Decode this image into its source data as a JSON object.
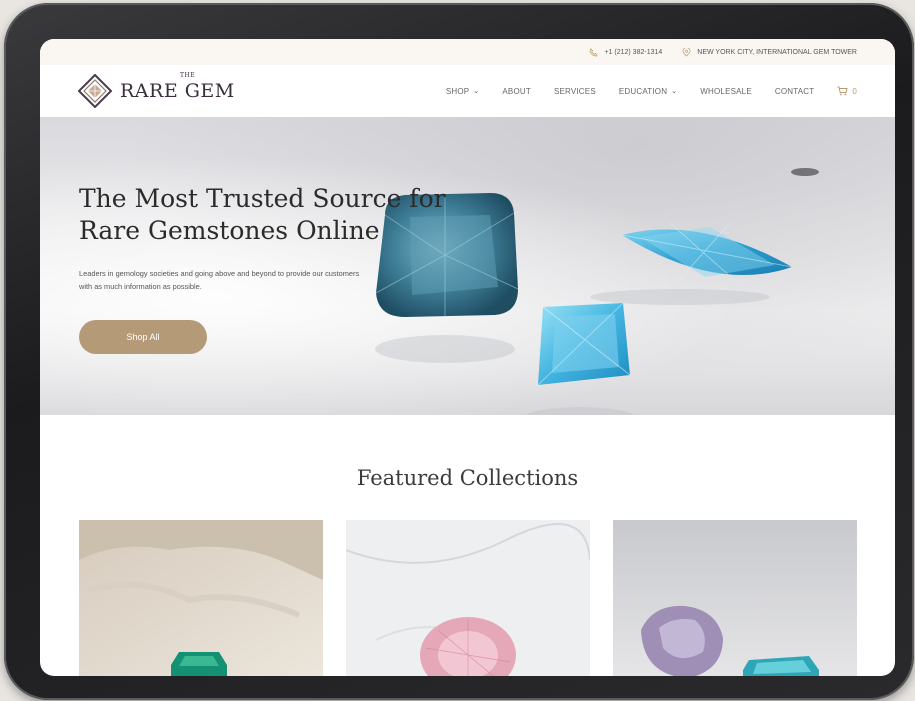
{
  "topbar": {
    "phone": "+1 (212) 382-1314",
    "location": "NEW YORK CITY, INTERNATIONAL GEM TOWER"
  },
  "logo": {
    "the": "THE",
    "name": "RARE GEM"
  },
  "menu": {
    "items": [
      "SHOP",
      "ABOUT",
      "SERVICES",
      "EDUCATION",
      "WHOLESALE",
      "CONTACT"
    ],
    "cart_count": "0"
  },
  "hero": {
    "title": "The Most Trusted Source for Rare Gemstones Online",
    "subtitle": "Leaders in gemology societies and going above and beyond to provide our customers with as much information as possible.",
    "button": "Shop All"
  },
  "featured": {
    "title": "Featured Collections"
  },
  "colors": {
    "accent": "#b59a78",
    "topbar_bg": "#faf7f2",
    "logo_text": "#3a2e3c"
  },
  "icons": [
    "phone-icon",
    "location-pin-icon",
    "cart-icon",
    "chevron-down-icon"
  ]
}
